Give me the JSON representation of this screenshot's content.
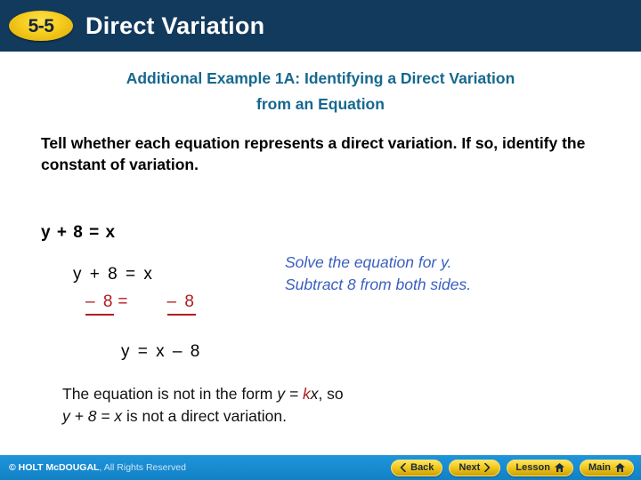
{
  "header": {
    "badge_label": "5-5",
    "title": "Direct Variation",
    "bg_color": "#123a5c",
    "badge_color": "#f5cc1e"
  },
  "subtitle": {
    "line1": "Additional Example 1A: Identifying a Direct Variation",
    "line2": "from an Equation",
    "color": "#16688f"
  },
  "body": {
    "prompt": "Tell whether each equation represents a direct variation. If so, identify the constant of variation.",
    "equation_given": "y + 8 = x",
    "work": {
      "line1": "y + 8 = x",
      "subtract_left": "– 8",
      "equals": "=",
      "subtract_right": "– 8",
      "color": "#b01c22"
    },
    "annotation": {
      "line1": "Solve the equation for y.",
      "line2": "Subtract 8 from both sides.",
      "color": "#3b5fc0"
    },
    "equation_result": "y = x – 8",
    "conclusion": {
      "part1": "The equation is not in the form ",
      "formula_prefix": "y = ",
      "formula_k": "k",
      "formula_suffix": "x",
      "part2": ", so",
      "line2_eq": "y + 8 = x",
      "line2_rest": " is not a direct variation."
    }
  },
  "footer": {
    "copyright_bold": "© HOLT McDOUGAL",
    "copyright_rest": ", All Rights Reserved",
    "bg_color": "#1a8fd4",
    "buttons": [
      {
        "label": "Back",
        "icon": "chevron-left-icon",
        "icon_side": "left"
      },
      {
        "label": "Next",
        "icon": "chevron-right-icon",
        "icon_side": "right"
      },
      {
        "label": "Lesson",
        "icon": "home-icon",
        "icon_side": "right"
      },
      {
        "label": "Main",
        "icon": "home-icon",
        "icon_side": "right"
      }
    ]
  }
}
